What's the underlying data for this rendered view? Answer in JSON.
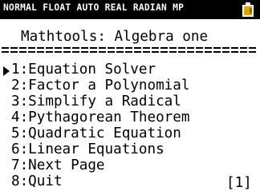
{
  "status_bar": {
    "text": "NORMAL FLOAT AUTO REAL RADIAN MP"
  },
  "title": "Mathtools: Algebra one",
  "menu_items": [
    "1:Equation Solver",
    "2:Factor a Polynomial",
    "3:Simplify a Radical",
    "4:Pythagorean Theorem",
    "5:Quadratic Equation",
    "6:Linear Equations",
    "7:Next Page",
    "8:Quit"
  ],
  "page_indicator": "[1]",
  "colors": {
    "status_bg": "#000000",
    "status_text": "#ffffff",
    "battery_fill": "#e8a000",
    "text": "#000000",
    "background": "#ffffff"
  }
}
